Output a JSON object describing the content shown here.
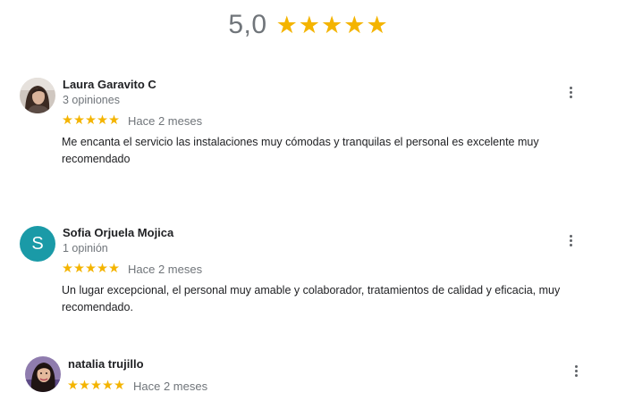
{
  "summary": {
    "score": "5,0",
    "stars": 5
  },
  "colors": {
    "star": "#f4b400",
    "secondary_text": "#70757a",
    "avatar_s_bg": "#1a9aa7"
  },
  "reviews": [
    {
      "author": "Laura Garavito C",
      "count": "3 opiniones",
      "stars": 5,
      "date": "Hace 2 meses",
      "text": "Me encanta el servicio las instalaciones muy cómodas y tranquilas el personal es excelente muy recomendado",
      "avatar": "photo",
      "menu_icon": "more-vert-icon"
    },
    {
      "author": "Sofia Orjuela Mojica",
      "count": "1 opinión",
      "stars": 5,
      "date": "Hace 2 meses",
      "text": "Un lugar excepcional, el personal muy amable y colaborador, tratamientos de calidad y eficacia, muy recomendado.",
      "avatar": "S",
      "menu_icon": "more-vert-icon"
    },
    {
      "author": "natalia trujillo",
      "stars": 5,
      "date": "Hace 2 meses",
      "avatar": "photo",
      "menu_icon": "more-vert-icon"
    }
  ]
}
